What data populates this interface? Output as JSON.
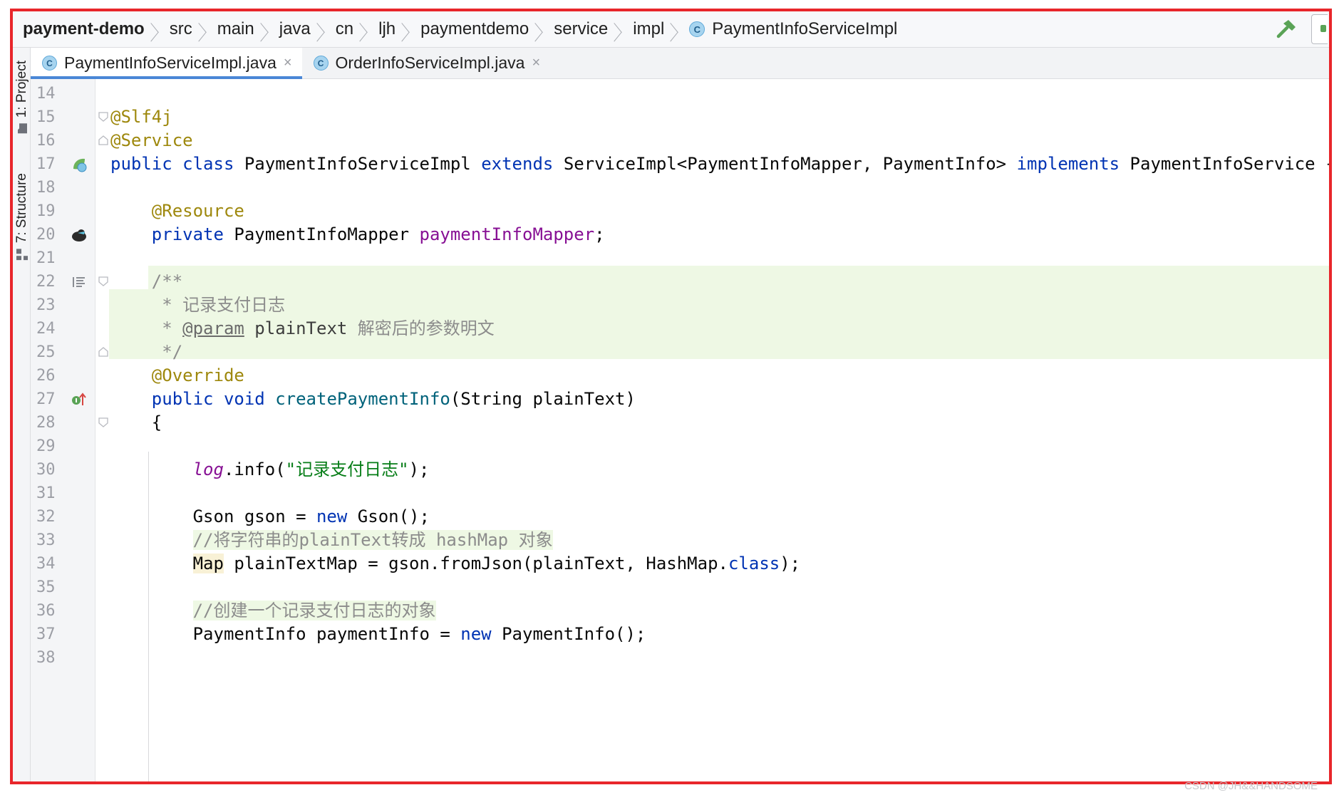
{
  "breadcrumbs": [
    "payment-demo",
    "src",
    "main",
    "java",
    "cn",
    "ljh",
    "paymentdemo",
    "service",
    "impl",
    "PaymentInfoServiceImpl"
  ],
  "toolwindows": {
    "project": "1: Project",
    "structure": "7: Structure"
  },
  "tabs": [
    {
      "label": "PaymentInfoServiceImpl.java",
      "active": true
    },
    {
      "label": "OrderInfoServiceImpl.java",
      "active": false
    }
  ],
  "class_icon_letter": "C",
  "close_glyph": "×",
  "code": {
    "line_numbers": [
      "14",
      "15",
      "16",
      "17",
      "18",
      "19",
      "20",
      "21",
      "22",
      "23",
      "24",
      "25",
      "26",
      "27",
      "28",
      "29",
      "30",
      "31",
      "32",
      "33",
      "34",
      "35",
      "36",
      "37",
      "38"
    ],
    "l15": "@Slf4j",
    "l16": "@Service",
    "l17": {
      "kw1": "public",
      "kw2": "class",
      "name": "PaymentInfoServiceImpl",
      "kw3": "extends",
      "parent": "ServiceImpl<PaymentInfoMapper, PaymentInfo>",
      "kw4": "implements",
      "iface": "PaymentInfoService {"
    },
    "l19": "@Resource",
    "l20": {
      "kw": "private",
      "type": "PaymentInfoMapper",
      "field": "paymentInfoMapper",
      "tail": ";"
    },
    "l22": "/**",
    "l23": " * 记录支付日志",
    "l24": {
      "prefix": " * ",
      "tag": "@param",
      "param": " plainText",
      "desc": " 解密后的参数明文"
    },
    "l25": " */",
    "l26": "@Override",
    "l27": {
      "kw1": "public",
      "kw2": "void",
      "method": "createPaymentInfo",
      "params": "(String plainText)"
    },
    "l28": "{",
    "l30": {
      "log": "log",
      "call": ".info(",
      "str": "\"记录支付日志\"",
      "tail": ");"
    },
    "l32": {
      "decl": "Gson gson = ",
      "kw": "new",
      "tail": " Gson();"
    },
    "l33": "//将字符串的plainText转成 hashMap 对象",
    "l34": {
      "type": "Map",
      "rest": " plainTextMap = gson.fromJson(plainText, HashMap.",
      "kw": "class",
      "tail": ");"
    },
    "l36": "//创建一个记录支付日志的对象",
    "l37": {
      "decl": "PaymentInfo paymentInfo = ",
      "kw": "new",
      "tail": " PaymentInfo();"
    }
  },
  "watermark": "CSDN @JH&&HANDSOME",
  "colors": {
    "frame_border": "#e8262b",
    "keyword": "#0033b3",
    "annotation": "#9e880d",
    "field": "#871094",
    "method": "#00627a",
    "string": "#067d17",
    "comment": "#8c8c8c",
    "doc_highlight": "#eef8e4",
    "tab_underline": "#4a87d6"
  },
  "icons": [
    "class-icon",
    "hammer-icon",
    "folder-icon",
    "structure-icon",
    "spring-bean-icon",
    "mybatis-bird-icon",
    "doc-rendered-icon",
    "override-arrow-icon",
    "fold-marker-icon",
    "close-icon"
  ]
}
